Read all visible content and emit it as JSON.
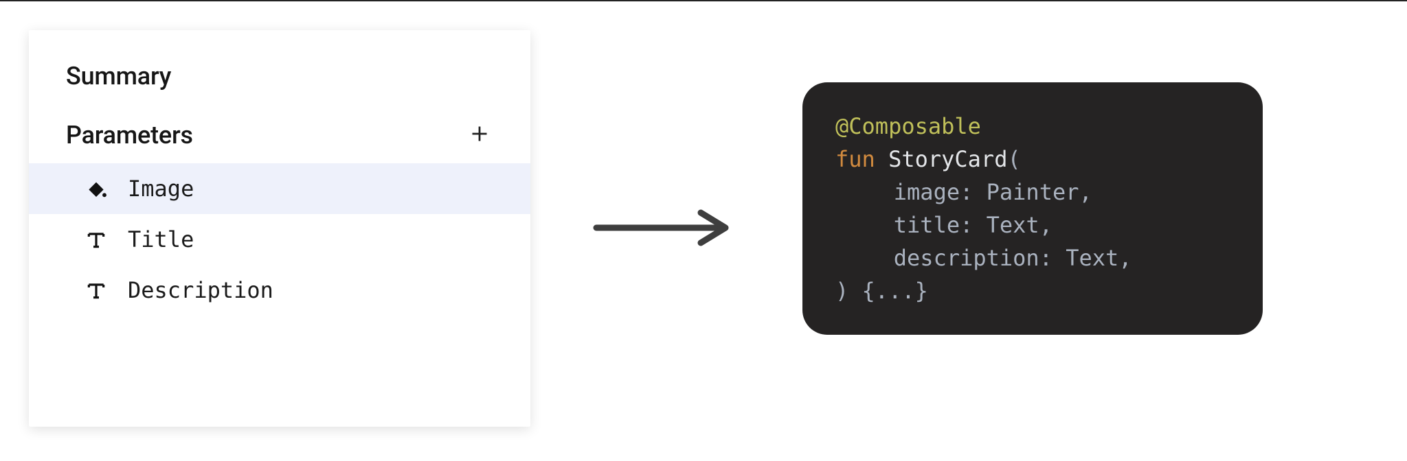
{
  "panel": {
    "heading_summary": "Summary",
    "section_parameters": "Parameters",
    "items": [
      {
        "label": "Image",
        "icon": "paint-bucket",
        "selected": true
      },
      {
        "label": "Title",
        "icon": "text",
        "selected": false
      },
      {
        "label": "Description",
        "icon": "text",
        "selected": false
      }
    ]
  },
  "code": {
    "annotation": "@Composable",
    "keyword_fun": "fun",
    "function_name": "StoryCard",
    "open": "(",
    "params": [
      {
        "name": "image",
        "type": "Painter"
      },
      {
        "name": "title",
        "type": "Text"
      },
      {
        "name": "description",
        "type": "Text"
      }
    ],
    "close_and_body": ") {...}"
  }
}
